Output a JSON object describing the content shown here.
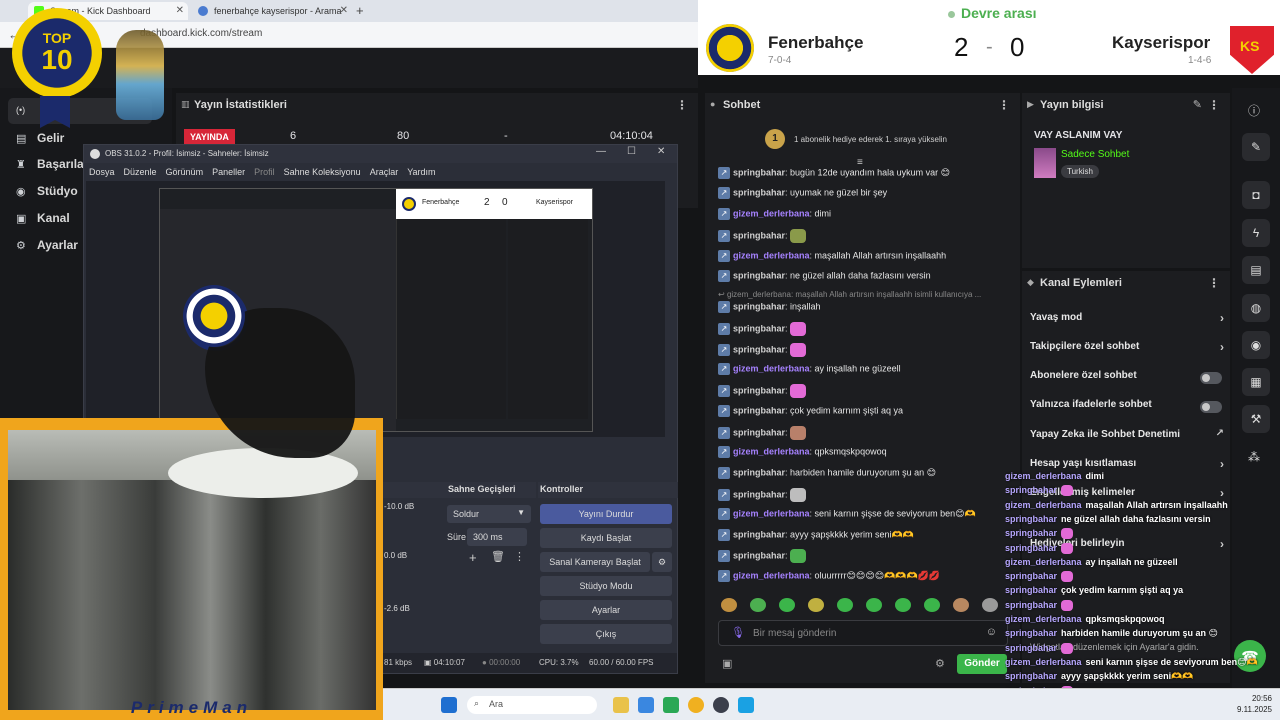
{
  "browser": {
    "tabs": [
      {
        "title": "Stream - Kick Dashboard"
      },
      {
        "title": "fenerbahçe kayserispor - Arama"
      }
    ],
    "url": "dashboard.kick.com/stream"
  },
  "scoreboard": {
    "status": "Devre arası",
    "home": {
      "name": "Fenerbahçe",
      "record": "7-0-4",
      "score": "2"
    },
    "away": {
      "name": "Kayserispor",
      "record": "1-4-6",
      "score": "0"
    },
    "separator": "-"
  },
  "top10_badge": {
    "line1": "TOP",
    "line2": "10"
  },
  "sidebar": {
    "items": [
      {
        "label": "Gelir",
        "icon": "page-icon"
      },
      {
        "label": "Başarılar",
        "icon": "trophy-icon"
      },
      {
        "label": "Stüdyo",
        "icon": "gamepad-icon"
      },
      {
        "label": "Kanal",
        "icon": "channel-icon"
      },
      {
        "label": "Ayarlar",
        "icon": "gear-icon"
      }
    ]
  },
  "stats": {
    "title": "Yayın İstatistikleri",
    "live": "YAYINDA",
    "viewers": "6",
    "followers": "80",
    "dash": "-",
    "uptime": "04:10:04"
  },
  "chat": {
    "title": "Sohbet",
    "pinned": "1 abonelik hediye ederek 1. sıraya yükselin",
    "pinned_rank": "1",
    "reply_context": "gizem_derlerbana: maşallah Allah artırsın inşallaahh isimli kullanıcıya ...",
    "messages": [
      {
        "user": "springbahar",
        "text": "bugün 12de uyandım hala uykum var 😊",
        "color": "#d0d0d0"
      },
      {
        "user": "springbahar",
        "text": "uyumak ne güzel bir şey",
        "color": "#d0d0d0"
      },
      {
        "user": "gizem_derlerbana",
        "text": "dimi",
        "color": "#a682ff"
      },
      {
        "user": "springbahar",
        "text": "",
        "color": "#d0d0d0",
        "emote": "#8a9a4a"
      },
      {
        "user": "gizem_derlerbana",
        "text": "maşallah Allah artırsın inşallaahh",
        "color": "#a682ff"
      },
      {
        "user": "springbahar",
        "text": "ne güzel allah daha fazlasını versin",
        "color": "#d0d0d0"
      },
      {
        "user": "springbahar",
        "text": "inşallah",
        "color": "#d0d0d0"
      },
      {
        "user": "springbahar",
        "text": "",
        "color": "#d0d0d0",
        "emote": "#e26ad6"
      },
      {
        "user": "springbahar",
        "text": "",
        "color": "#d0d0d0",
        "emote": "#e26ad6"
      },
      {
        "user": "gizem_derlerbana",
        "text": "ay inşallah ne güzeell",
        "color": "#a682ff"
      },
      {
        "user": "springbahar",
        "text": "",
        "color": "#d0d0d0",
        "emote": "#e26ad6"
      },
      {
        "user": "springbahar",
        "text": "çok yedim karnım şişti aq ya",
        "color": "#d0d0d0"
      },
      {
        "user": "springbahar",
        "text": "",
        "color": "#d0d0d0",
        "emote": "#b8806a"
      },
      {
        "user": "gizem_derlerbana",
        "text": "qpksmqskpqowoq",
        "color": "#a682ff"
      },
      {
        "user": "springbahar",
        "text": "harbiden hamile duruyorum şu an 😊",
        "color": "#d0d0d0"
      },
      {
        "user": "springbahar",
        "text": "",
        "color": "#d0d0d0",
        "emote": "#bdbdbd"
      },
      {
        "user": "gizem_derlerbana",
        "text": "seni karnın şişse de seviyorum ben😊🫶",
        "color": "#a682ff"
      },
      {
        "user": "springbahar",
        "text": "ayyy şapşkkkk yerim seni🫶🫶",
        "color": "#d0d0d0"
      },
      {
        "user": "springbahar",
        "text": "",
        "color": "#d0d0d0",
        "emote": "#4caf50"
      },
      {
        "user": "gizem_derlerbana",
        "text": "oluurrrrr😊😊😊😊🫶🫶🫶💋💋",
        "color": "#a682ff"
      }
    ],
    "emote_bar_colors": [
      "#c08f40",
      "#4caf50",
      "#3bb54a",
      "#c0b040",
      "#3bb54a",
      "#3bb54a",
      "#3bb54a",
      "#3bb54a",
      "#b88860",
      "#9a9a9a"
    ],
    "input_placeholder": "Bir mesaj gönderin",
    "send_label": "Gönder"
  },
  "stream_info": {
    "title": "Yayın bilgisi",
    "stream_title": "VAY ASLANIM VAY",
    "category": "Sadece Sohbet",
    "tag": "Turkish"
  },
  "channel_actions": {
    "title": "Kanal Eylemleri",
    "items": [
      {
        "label": "Yavaş mod",
        "kind": "chevron"
      },
      {
        "label": "Takipçilere özel sohbet",
        "kind": "chevron"
      },
      {
        "label": "Abonelere özel sohbet",
        "kind": "toggle"
      },
      {
        "label": "Yalnızca ifadelerle sohbet",
        "kind": "toggle"
      },
      {
        "label": "Yapay Zeka ile Sohbet Denetimi",
        "kind": "external"
      },
      {
        "label": "Hesap yaşı kısıtlaması",
        "kind": "chevron"
      },
      {
        "label": "Engellenmiş kelimeler",
        "kind": "chevron"
      },
      {
        "label": "Hediyeleri belirleyin",
        "kind": "chevron"
      }
    ],
    "settings_hint": "Widgetları düzenlemek için Ayarlar'a gidin."
  },
  "obs": {
    "title": "OBS 31.0.2 - Profil: İsimsiz - Sahneler: İsimsiz",
    "menu": [
      "Dosya",
      "Düzenle",
      "Görünüm",
      "Paneller",
      "Profil",
      "Sahne Koleksiyonu",
      "Araçlar",
      "Yardım"
    ],
    "transitions_title": "Sahne Geçişleri",
    "transition_value": "Soldur",
    "duration_label": "Süre",
    "duration_value": "300 ms",
    "controls_title": "Kontroller",
    "controls": [
      "Yayını Durdur",
      "Kaydı Başlat",
      "Sanal Kamerayı Başlat",
      "Stüdyo Modu",
      "Ayarlar",
      "Çıkış"
    ],
    "mixer_levels": [
      "-10.0 dB",
      "0.0 dB",
      "-2.6 dB"
    ],
    "status_bitrate": "81 kbps",
    "status_live": "04:10:07",
    "status_rec": "00:00:00",
    "status_cpu": "CPU: 3.7%",
    "status_fps": "60.00 / 60.00 FPS"
  },
  "overlay_chat": [
    {
      "user": "gizem_derlerbana",
      "text": "dimi"
    },
    {
      "user": "springbahar",
      "text": ""
    },
    {
      "user": "gizem_derlerbana",
      "text": "maşallah Allah artırsın inşallaahh"
    },
    {
      "user": "springbahar",
      "text": "ne güzel allah daha fazlasını versin"
    },
    {
      "user": "springbahar",
      "text": ""
    },
    {
      "user": "springbahar",
      "text": ""
    },
    {
      "user": "gizem_derlerbana",
      "text": "ay inşallah ne güzeell"
    },
    {
      "user": "springbahar",
      "text": ""
    },
    {
      "user": "springbahar",
      "text": "çok yedim karnım şişti aq ya"
    },
    {
      "user": "springbahar",
      "text": ""
    },
    {
      "user": "gizem_derlerbana",
      "text": "qpksmqskpqowoq"
    },
    {
      "user": "springbahar",
      "text": "harbiden hamile duruyorum şu an 😊"
    },
    {
      "user": "springbahar",
      "text": ""
    },
    {
      "user": "gizem_derlerbana",
      "text": "seni karnın şişse de seviyorum ben😊🫶"
    },
    {
      "user": "springbahar",
      "text": "ayyy şapşkkkk yerim seni🫶🫶"
    },
    {
      "user": "springbahar",
      "text": ""
    },
    {
      "user": "gizem_derlerbana",
      "text": "oluurrrrr😊😊😊🫶🫶💋💋"
    }
  ],
  "webcam": {
    "name": "PrimeMan"
  },
  "taskbar": {
    "search_placeholder": "Ara",
    "time": "20:56",
    "date": "9.11.2025"
  },
  "colors": {
    "kick_green": "#53fc18",
    "live_red": "#d72638",
    "send_green": "#3bb54a",
    "fb_yellow": "#f4d000",
    "fb_navy": "#1b2a6b",
    "kayseri_red": "#e0212c"
  }
}
